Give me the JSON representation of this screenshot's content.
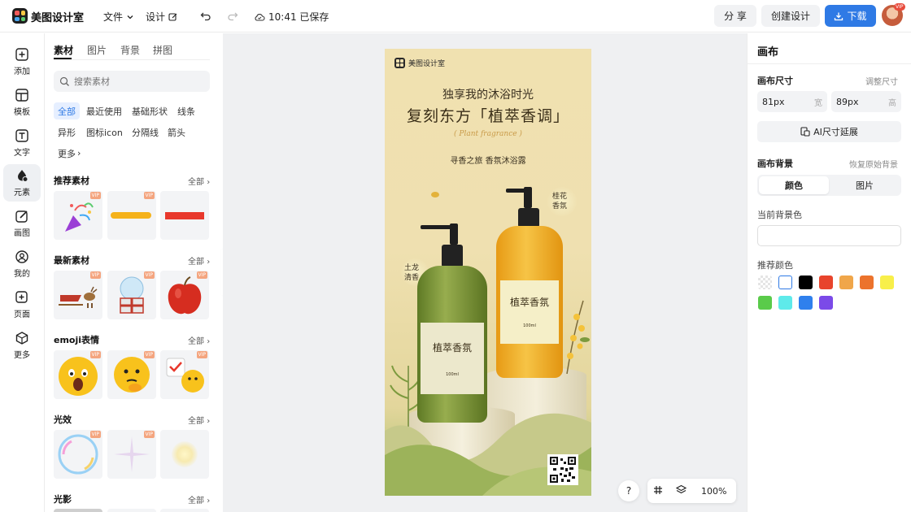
{
  "app": {
    "name": "美图设计室"
  },
  "topbar": {
    "file_menu": "文件",
    "design_menu": "设计",
    "save_status": "10:41 已保存",
    "share_label": "分 享",
    "create_label": "创建设计",
    "download_label": "下载",
    "avatar_badge": "VIP"
  },
  "leftnav": [
    {
      "label": "添加",
      "icon": "plus-square-icon"
    },
    {
      "label": "模板",
      "icon": "template-icon"
    },
    {
      "label": "文字",
      "icon": "text-icon"
    },
    {
      "label": "元素",
      "icon": "shapes-icon"
    },
    {
      "label": "画图",
      "icon": "draw-icon"
    },
    {
      "label": "我的",
      "icon": "user-icon"
    },
    {
      "label": "页面",
      "icon": "page-add-icon"
    },
    {
      "label": "更多",
      "icon": "cube-icon"
    }
  ],
  "panel": {
    "tabs": [
      "素材",
      "图片",
      "背景",
      "拼图"
    ],
    "search_placeholder": "搜索素材",
    "chips": [
      "全部",
      "最近使用",
      "基础形状",
      "线条",
      "异形",
      "图标icon",
      "分隔线",
      "箭头",
      "更多"
    ],
    "all_label": "全部",
    "vip_label": "VIP",
    "sections": [
      {
        "title": "推荐素材"
      },
      {
        "title": "最新素材"
      },
      {
        "title": "emoji表情"
      },
      {
        "title": "光效"
      },
      {
        "title": "光影"
      }
    ]
  },
  "poster": {
    "brand": "美图设计室",
    "subtitle": "独享我的沐浴时光",
    "headline": "复刻东方「植萃香调」",
    "english": "( Plant fragrance )",
    "tagline": "寻香之旅 香氛沐浴露",
    "label_left_top": "土龙",
    "label_left_bottom": "清香",
    "label_right_top": "桂花",
    "label_right_bottom": "香氛",
    "bottle_text": "植萃香氛",
    "bottle_volume": "100ml"
  },
  "bottom": {
    "zoom": "100%",
    "help": "?"
  },
  "rightpanel": {
    "title": "画布",
    "size_label": "画布尺寸",
    "size_link": "调整尺寸",
    "width_value": "81px",
    "width_unit": "宽",
    "height_value": "89px",
    "height_unit": "高",
    "ai_button": "AI尺寸延展",
    "bg_label": "画布背景",
    "bg_link": "恢复原始背景",
    "seg_color": "颜色",
    "seg_image": "图片",
    "current_color_label": "当前背景色",
    "recommend_label": "推荐颜色",
    "swatches": [
      "transparent",
      "#ffffff",
      "#000000",
      "#e8442c",
      "#f0a64a",
      "#ec732c",
      "#f8ef4a",
      "#5acb4a",
      "#5eeaea",
      "#2f80ed",
      "#7b4ae8"
    ]
  }
}
